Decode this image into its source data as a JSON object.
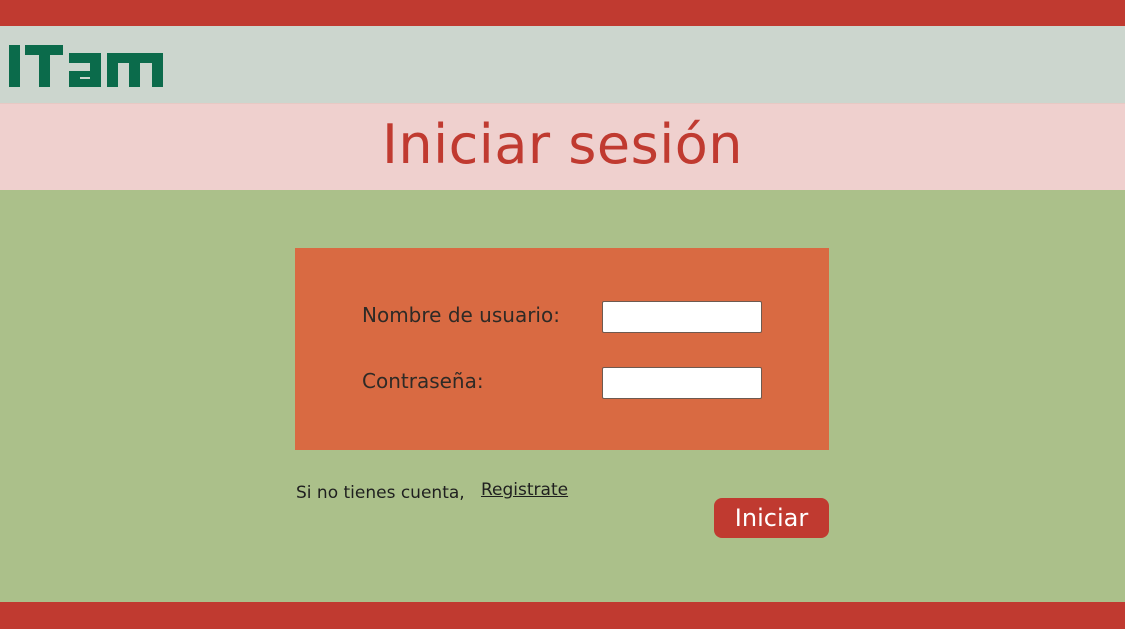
{
  "header": {
    "logo_text": "ITAM",
    "logo_color": "#0b6b4b"
  },
  "title_band": {
    "title": "Iniciar sesión"
  },
  "login_form": {
    "username_label": "Nombre de usuario:",
    "username_value": "",
    "password_label": "Contraseña:",
    "password_value": ""
  },
  "signup": {
    "prompt": "Si no tienes cuenta,",
    "link_label": "Registrate"
  },
  "submit": {
    "label": "Iniciar"
  },
  "colors": {
    "brand_red": "#c03a30",
    "header_gray": "#ccd6ce",
    "title_band_pink": "#efd0ce",
    "page_green": "#abc08a",
    "form_orange": "#d96a42"
  }
}
